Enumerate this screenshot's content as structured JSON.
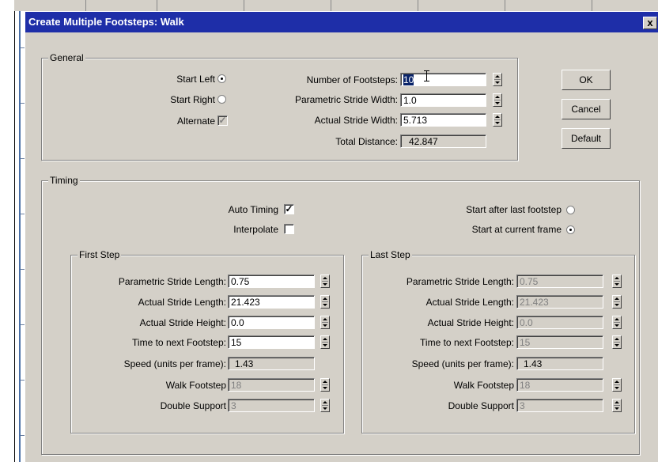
{
  "dialog": {
    "title": "Create Multiple Footsteps: Walk",
    "close": "x"
  },
  "general": {
    "label": "General",
    "start_left": "Start Left",
    "start_left_selected": true,
    "start_right": "Start Right",
    "alternate": "Alternate",
    "alternate_checked": true,
    "num_footsteps_label": "Number of Footsteps:",
    "num_footsteps_value": "10",
    "param_stride_width_label": "Parametric Stride Width:",
    "param_stride_width_value": "1.0",
    "actual_stride_width_label": "Actual Stride Width:",
    "actual_stride_width_value": "5.713",
    "total_distance_label": "Total Distance:",
    "total_distance_value": "42.847"
  },
  "buttons": {
    "ok": "OK",
    "cancel": "Cancel",
    "default": "Default"
  },
  "timing": {
    "label": "Timing",
    "auto_timing": "Auto Timing",
    "auto_timing_checked": true,
    "interpolate": "Interpolate",
    "interpolate_checked": false,
    "start_after_last": "Start after last footstep",
    "start_at_current": "Start at current frame",
    "start_at_current_selected": true
  },
  "first_step": {
    "label": "First Step",
    "param_stride_length_label": "Parametric Stride Length:",
    "param_stride_length_value": "0.75",
    "actual_stride_length_label": "Actual Stride Length:",
    "actual_stride_length_value": "21.423",
    "actual_stride_height_label": "Actual Stride Height:",
    "actual_stride_height_value": "0.0",
    "time_next_label": "Time to next Footstep:",
    "time_next_value": "15",
    "speed_label": "Speed (units per frame):",
    "speed_value": "1.43",
    "walk_footstep_label": "Walk Footstep",
    "walk_footstep_value": "18",
    "double_support_label": "Double Support",
    "double_support_value": "3"
  },
  "last_step": {
    "label": "Last Step",
    "param_stride_length_label": "Parametric Stride Length:",
    "param_stride_length_value": "0.75",
    "actual_stride_length_label": "Actual Stride Length:",
    "actual_stride_length_value": "21.423",
    "actual_stride_height_label": "Actual Stride Height:",
    "actual_stride_height_value": "0.0",
    "time_next_label": "Time to next Footstep:",
    "time_next_value": "15",
    "speed_label": "Speed (units per frame):",
    "speed_value": "1.43",
    "walk_footstep_label": "Walk Footstep",
    "walk_footstep_value": "18",
    "double_support_label": "Double Support",
    "double_support_value": "3"
  },
  "colors": {
    "titlebar": "#1e2ea8",
    "dialog_bg": "#d4d0c8"
  }
}
